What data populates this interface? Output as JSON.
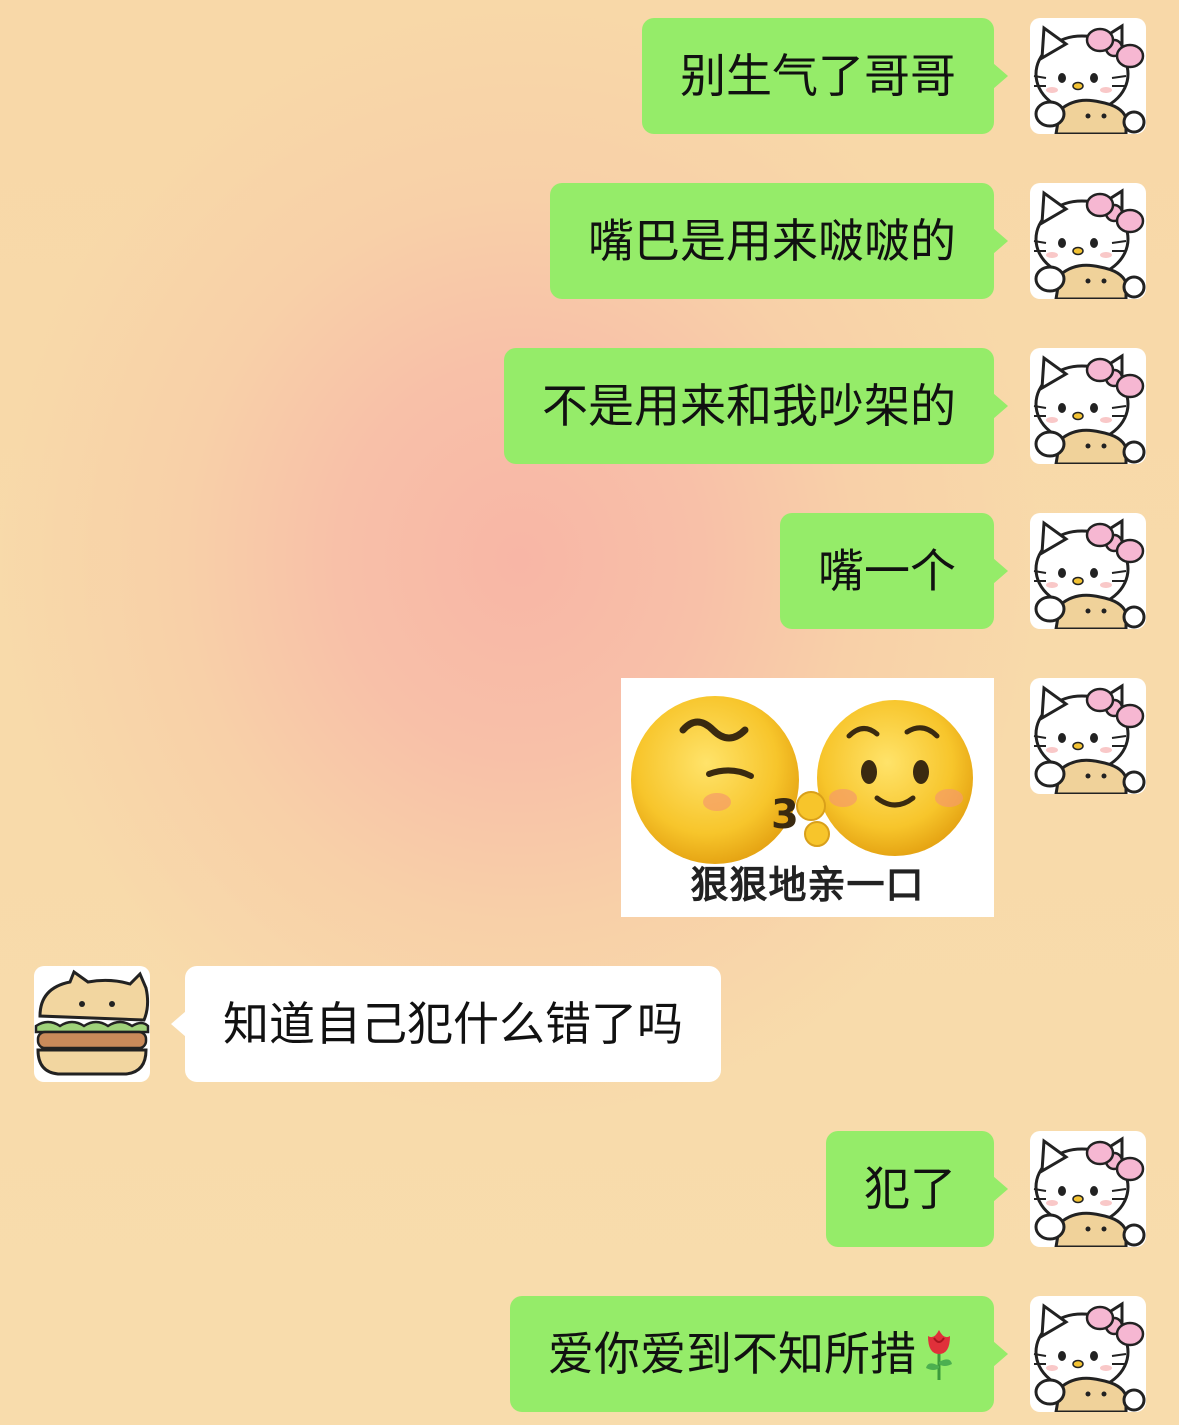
{
  "chat": {
    "messages": [
      {
        "id": "m1",
        "side": "out",
        "text": "别生气了哥哥"
      },
      {
        "id": "m2",
        "side": "out",
        "text": "嘴巴是用来啵啵的"
      },
      {
        "id": "m3",
        "side": "out",
        "text": "不是用来和我吵架的"
      },
      {
        "id": "m4",
        "side": "out",
        "text": "嘴一个"
      },
      {
        "id": "m5",
        "side": "out",
        "type": "sticker",
        "caption": "狠狠地亲一口"
      },
      {
        "id": "m6",
        "side": "in",
        "text": "知道自己犯什么错了吗"
      },
      {
        "id": "m7",
        "side": "out",
        "text": "犯了"
      },
      {
        "id": "m8",
        "side": "out",
        "text": "爱你爱到不知所措",
        "emoji": "rose-emoji"
      }
    ]
  },
  "avatars": {
    "self": "hello-kitty-avatar",
    "other": "burger-bear-avatar"
  },
  "colors": {
    "out_bubble": "#95ec69",
    "in_bubble": "#ffffff",
    "background": "#f8dca8",
    "background_center": "#f8b6a6"
  }
}
